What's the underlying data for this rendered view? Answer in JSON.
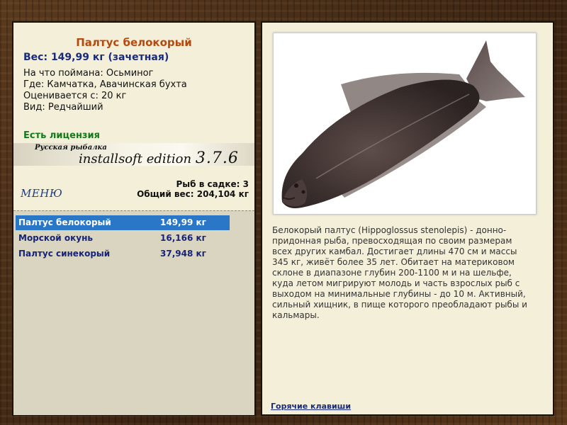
{
  "catch": {
    "title": "Палтус белокорый",
    "weight_line": "Вес: 149,99 кг (зачетная)",
    "bait": "На что поймана: Осьминог",
    "location": "Где: Камчатка, Авачинская бухта",
    "min_weight": "Оценивается с: 20 кг",
    "kind": "Вид: Редчайший",
    "license": "Есть лицензия"
  },
  "banner": {
    "small": "Русская рыбалка",
    "edition": "installsoft edition",
    "version": "3.7.6"
  },
  "menu_label": "МЕНЮ",
  "keepnet": {
    "count": "Рыб в садке: 3",
    "total": "Общий вес: 204,104 кг",
    "fish": [
      {
        "name": "Палтус белокорый",
        "weight": "149,99 кг",
        "selected": true
      },
      {
        "name": "Морской окунь",
        "weight": "16,166 кг",
        "selected": false
      },
      {
        "name": "Палтус синекорый",
        "weight": "37,948 кг",
        "selected": false
      }
    ]
  },
  "description": "Белокорый палтус (Hippoglossus stenolepis) - донно-придонная рыба, превосходящая по своим размерам всех других камбал. Достигает длины 470 см и массы 345 кг, живёт более 35 лет. Обитает на материковом склоне в диапазоне глубин 200-1100 м и на шельфе, куда летом мигрируют молодь и часть взрослых рыб с выходом на минимальные глубины - до 10 м. Активный, сильный хищник, в пище которого преобладают рыбы и кальмары.",
  "hotkeys_label": "Горячие клавиши",
  "colors": {
    "title": "#b8490e",
    "accent": "#1b2a7d",
    "license": "#15791b",
    "selected_row": "#2a76c7"
  }
}
